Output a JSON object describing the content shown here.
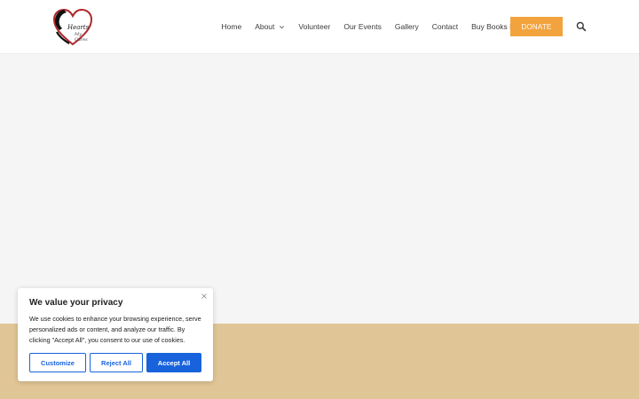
{
  "header": {
    "logo": {
      "line1": "Hearts",
      "line2": "My Cares"
    },
    "nav": [
      {
        "label": "Home"
      },
      {
        "label": "About"
      },
      {
        "label": "Volunteer"
      },
      {
        "label": "Our Events"
      },
      {
        "label": "Gallery"
      },
      {
        "label": "Contact"
      },
      {
        "label": "Buy Books Here"
      }
    ],
    "donate_label": "DONATE"
  },
  "cookie_banner": {
    "title": "We value your privacy",
    "text": "We use cookies to enhance your browsing experience, serve personalized ads or content, and analyze our traffic. By clicking \"Accept All\", you consent to our use of cookies.",
    "customize_label": "Customize",
    "reject_label": "Reject All",
    "accept_label": "Accept All"
  },
  "colors": {
    "donate": "#f2a33d",
    "hero_bg": "#f5f5f5",
    "band_bg": "#e0c596",
    "primary_blue": "#1863dc"
  },
  "icons": {
    "about_dropdown": "chevron-down-icon",
    "search": "search-icon",
    "close": "close-icon",
    "logo": "heart-logo"
  }
}
